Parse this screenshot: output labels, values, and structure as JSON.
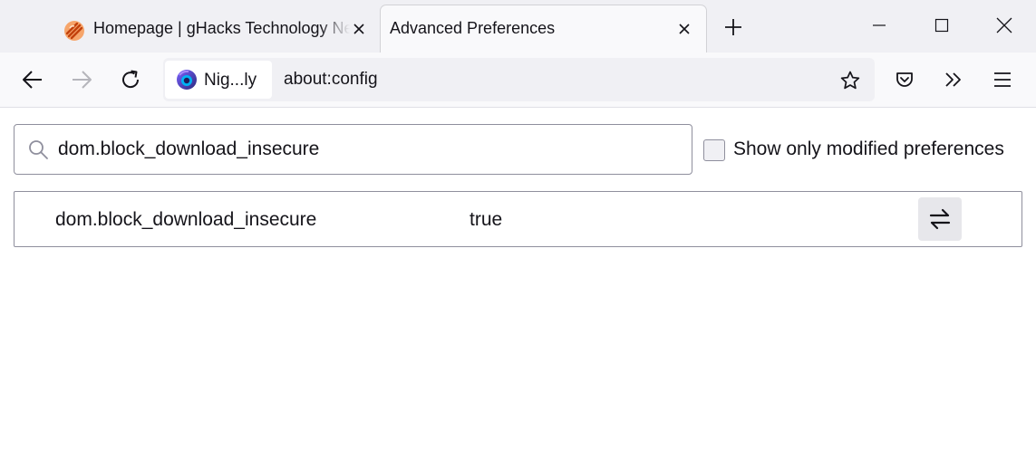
{
  "tabs": [
    {
      "title": "Homepage | gHacks Technology News",
      "favicon": "ghacks-favicon",
      "active": false
    },
    {
      "title": "Advanced Preferences",
      "active": true
    }
  ],
  "navbar": {
    "identity_label": "Nig...ly",
    "identity_icon": "firefox-nightly-logo",
    "url": "about:config"
  },
  "search": {
    "value": "dom.block_download_insecure",
    "icon": "search-icon"
  },
  "filter": {
    "label": "Show only modified preferences",
    "checked": false
  },
  "preferences": [
    {
      "name": "dom.block_download_insecure",
      "value": "true",
      "action_icon": "toggle-icon"
    }
  ],
  "colors": {
    "tabstrip_bg": "#f0f0f4",
    "toolbar_bg": "#f9f9fb",
    "text": "#15141a",
    "border": "#8f8f9d",
    "toggle_bg": "#e7e7eb"
  }
}
